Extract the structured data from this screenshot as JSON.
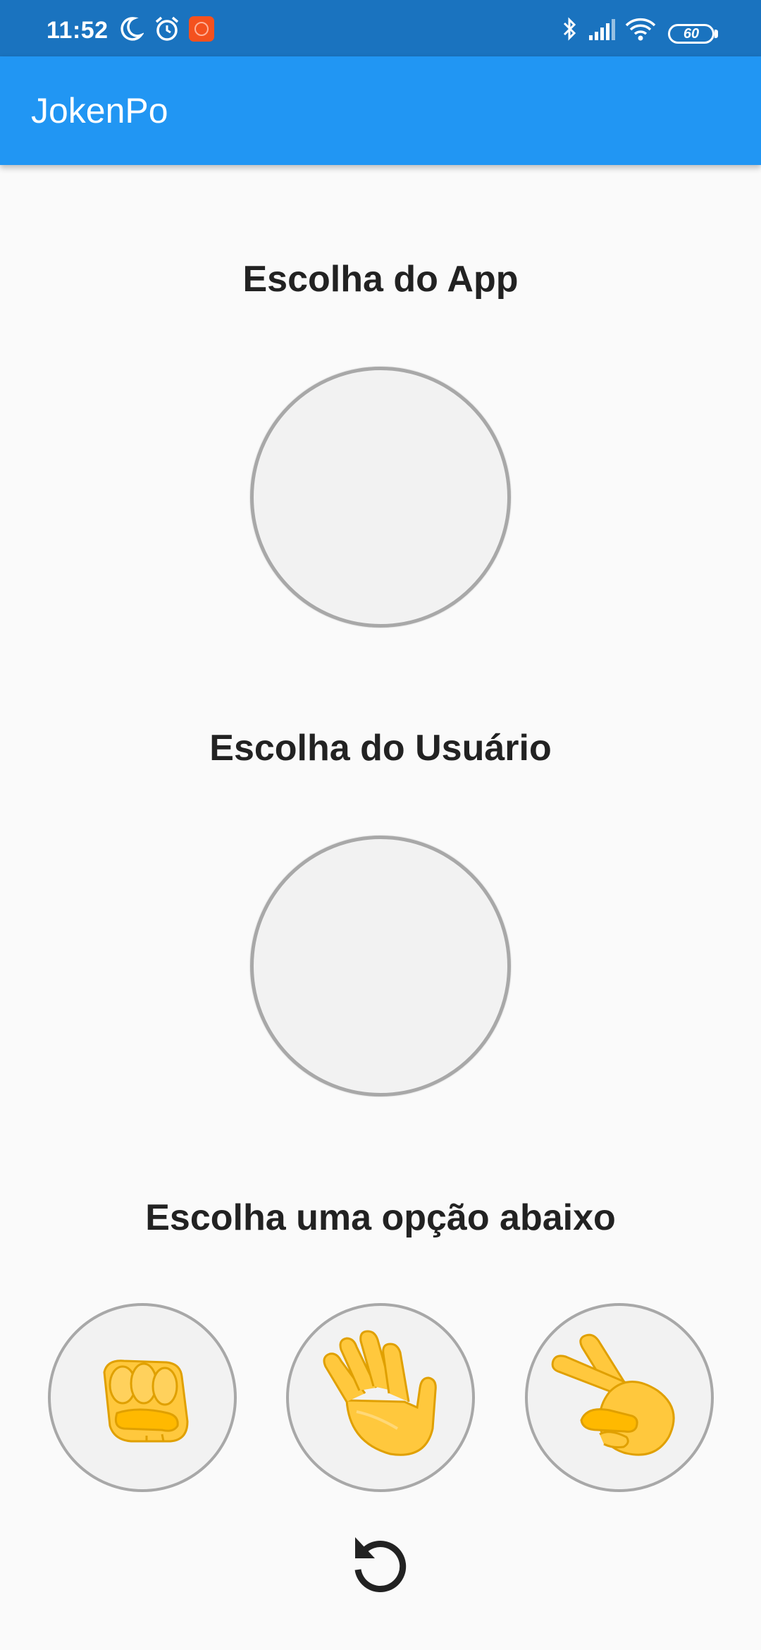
{
  "status_bar": {
    "time": "11:52",
    "battery": "60",
    "icons": [
      "moon-icon",
      "alarm-icon",
      "app-notification-icon",
      "bluetooth-icon",
      "signal-icon",
      "wifi-icon",
      "battery-icon"
    ]
  },
  "app_bar": {
    "title": "JokenPo",
    "color": "#2196f3"
  },
  "app_choice": {
    "title": "Escolha do App"
  },
  "user_choice": {
    "title": "Escolha do Usuário"
  },
  "options": {
    "title": "Escolha uma opção abaixo",
    "items": [
      {
        "icon": "fist-icon"
      },
      {
        "icon": "open-hand-icon"
      },
      {
        "icon": "victory-hand-icon"
      }
    ]
  },
  "reset": {
    "icon": "refresh-icon"
  }
}
